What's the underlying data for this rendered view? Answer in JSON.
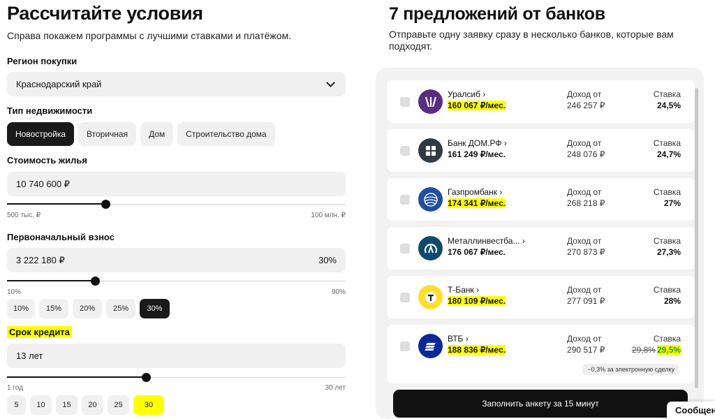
{
  "left": {
    "title": "Рассчитайте условия",
    "subtitle": "Справа покажем программы с лучшими ставками и платёжом.",
    "region": {
      "label": "Регион покупки",
      "value": "Краснодарский край"
    },
    "property_type": {
      "label": "Тип недвижимости",
      "options": [
        "Новостройка",
        "Вторичная",
        "Дом",
        "Строительство дома"
      ],
      "selected": "Новостройка"
    },
    "cost": {
      "label": "Стоимость жилья",
      "value": "10 740 600 ₽",
      "min_label": "500 тыс. ₽",
      "max_label": "100 млн. ₽",
      "slider_fraction": 0.29
    },
    "down_payment": {
      "label": "Первоначальный взнос",
      "value": "3 222 180 ₽",
      "percent": "30%",
      "min_label": "10%",
      "max_label": "90%",
      "slider_fraction": 0.26,
      "presets": [
        "10%",
        "15%",
        "20%",
        "25%",
        "30%"
      ],
      "selected": "30%"
    },
    "term": {
      "label": "Срок кредита",
      "value": "13 лет",
      "min_label": "1 год",
      "max_label": "30 лет",
      "slider_fraction": 0.41,
      "presets": [
        "5",
        "10",
        "15",
        "20",
        "25",
        "30"
      ]
    }
  },
  "right": {
    "title": "7 предложений от банков",
    "subtitle": "Отправьте одну заявку сразу в несколько банков, которые вам подходят.",
    "income_label": "Доход от",
    "rate_label": "Ставка",
    "offers": [
      {
        "bank": "Уралсиб",
        "payment": "160 067 ₽/мес.",
        "income": "246 257 ₽",
        "rate": "24,5%",
        "logo_color": "#5a2d82"
      },
      {
        "bank": "Банк ДОМ.РФ",
        "payment": "161 249 ₽/мес.",
        "income": "248 076 ₽",
        "rate": "24,7%",
        "logo_color": "#2f3a45"
      },
      {
        "bank": "Газпромбанк",
        "payment": "174 341 ₽/мес.",
        "income": "268 218 ₽",
        "rate": "27%",
        "logo_color": "#1f4fa0"
      },
      {
        "bank": "Металлинвестба...",
        "payment": "176 067 ₽/мес.",
        "income": "270 873 ₽",
        "rate": "27,3%",
        "logo_color": "#0e4a6e"
      },
      {
        "bank": "Т-Банк",
        "payment": "180 109 ₽/мес.",
        "income": "277 091 ₽",
        "rate": "28%",
        "logo_color": "#ffdd2d"
      },
      {
        "bank": "ВТБ",
        "payment": "188 836 ₽/мес.",
        "income": "290 517 ₽",
        "old_rate": "29,8%",
        "rate": "29,5%",
        "discount": "−0,3% за электронную сделку",
        "logo_color": "#0a2896"
      }
    ],
    "cta": "Заполнить анкету за 15 минут",
    "chat": "Сообщения"
  }
}
